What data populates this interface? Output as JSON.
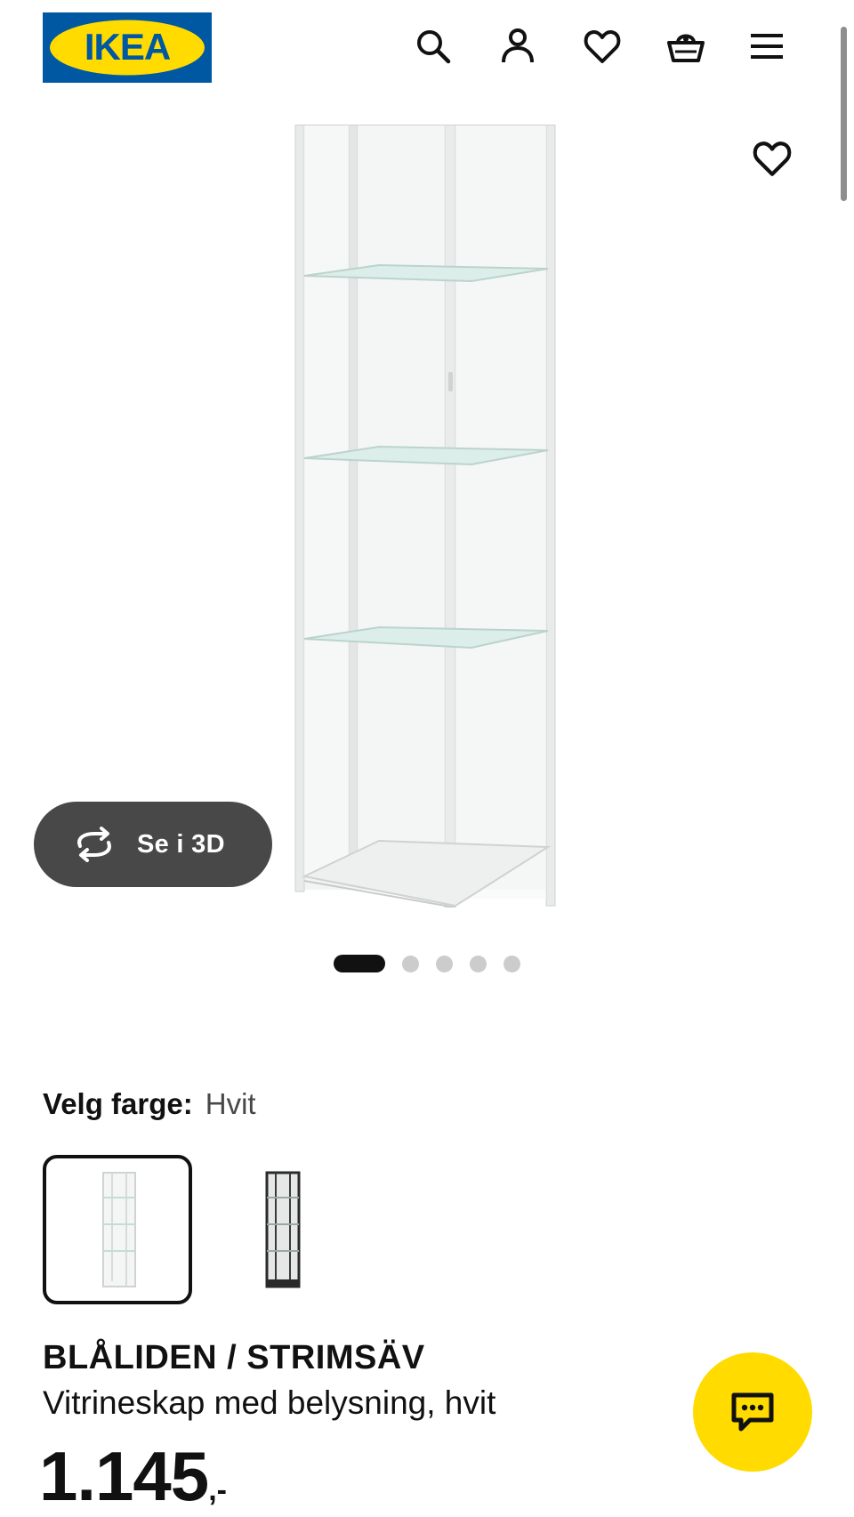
{
  "header": {
    "logo_text": "IKEA",
    "icons": [
      "search-icon",
      "account-icon",
      "heart-icon",
      "basket-icon",
      "menu-icon"
    ]
  },
  "gallery": {
    "image_alt": "",
    "view_3d_label": "Se i 3D",
    "slide_count": 5,
    "active_slide": 1
  },
  "color": {
    "label": "Velg farge:",
    "selected": "Hvit",
    "options": [
      "Hvit",
      "Svart"
    ]
  },
  "product": {
    "name": "BLÅLIDEN / STRIMSÄV",
    "description": "Vitrineskap med belysning, hvit",
    "price": "1.145",
    "price_suffix": ",-"
  },
  "colors": {
    "ikea_blue": "#0058a3",
    "ikea_yellow": "#ffdb00",
    "button_3d_bg": "#484848",
    "text": "#111111"
  }
}
